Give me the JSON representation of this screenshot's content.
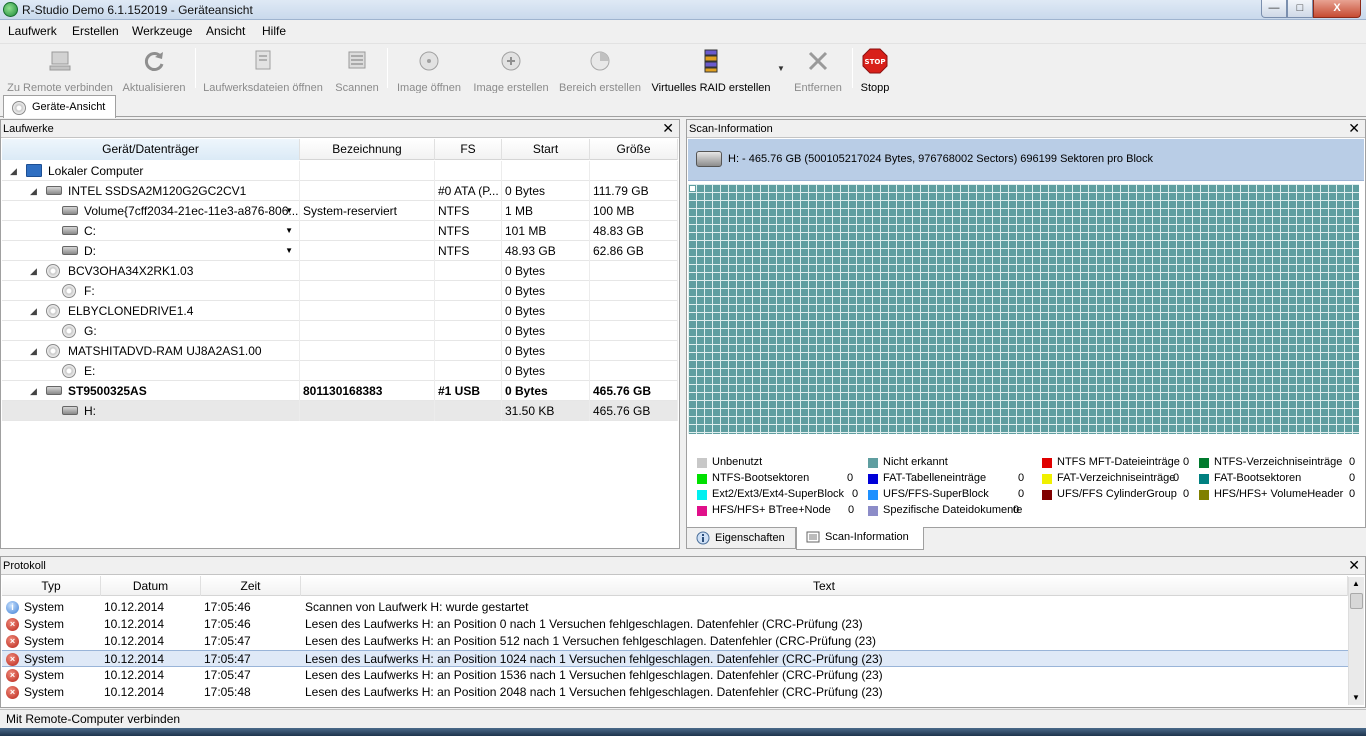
{
  "window": {
    "title": "R-Studio Demo 6.1.152019 - Geräteansicht",
    "min": "—",
    "max": "□",
    "close": "X"
  },
  "menu": [
    "Laufwerk",
    "Erstellen",
    "Werkzeuge",
    "Ansicht",
    "Hilfe"
  ],
  "toolbar": {
    "remote": "Zu Remote verbinden",
    "refresh": "Aktualisieren",
    "open_drive_files": "Laufwerksdateien öffnen",
    "scan": "Scannen",
    "open_image": "Image öffnen",
    "create_image": "Image erstellen",
    "create_region": "Bereich erstellen",
    "virtual_raid": "Virtuelles RAID erstellen",
    "remove": "Entfernen",
    "stop": "Stopp",
    "stop_icon_text": "STOP"
  },
  "tab_main": "Geräte-Ansicht",
  "drives": {
    "title": "Laufwerke",
    "columns": [
      "Gerät/Datenträger",
      "Bezeichnung",
      "FS",
      "Start",
      "Größe"
    ],
    "rows": [
      {
        "name": "Lokaler Computer",
        "label": "",
        "fs": "",
        "start": "",
        "size": ""
      },
      {
        "name": "INTEL SSDSA2M120G2GC2CV1",
        "label": "",
        "fs": "#0 ATA (P...",
        "start": "0 Bytes",
        "size": "111.79 GB"
      },
      {
        "name": "Volume{7cff2034-21ec-11e3-a876-806...",
        "label": "System-reserviert",
        "fs": "NTFS",
        "start": "1 MB",
        "size": "100 MB"
      },
      {
        "name": "C:",
        "label": "",
        "fs": "NTFS",
        "start": "101 MB",
        "size": "48.83 GB"
      },
      {
        "name": "D:",
        "label": "",
        "fs": "NTFS",
        "start": "48.93 GB",
        "size": "62.86 GB"
      },
      {
        "name": "BCV3OHA34X2RK1.03",
        "label": "",
        "fs": "",
        "start": "0 Bytes",
        "size": ""
      },
      {
        "name": "F:",
        "label": "",
        "fs": "",
        "start": "0 Bytes",
        "size": ""
      },
      {
        "name": "ELBYCLONEDRIVE1.4",
        "label": "",
        "fs": "",
        "start": "0 Bytes",
        "size": ""
      },
      {
        "name": "G:",
        "label": "",
        "fs": "",
        "start": "0 Bytes",
        "size": ""
      },
      {
        "name": "MATSHITADVD-RAM UJ8A2AS1.00",
        "label": "",
        "fs": "",
        "start": "0 Bytes",
        "size": ""
      },
      {
        "name": "E:",
        "label": "",
        "fs": "",
        "start": "0 Bytes",
        "size": ""
      },
      {
        "name": "ST9500325AS",
        "label": "801130168383",
        "fs": "#1 USB",
        "start": "0 Bytes",
        "size": "465.76 GB"
      },
      {
        "name": "H:",
        "label": "",
        "fs": "",
        "start": "31.50 KB",
        "size": "465.76 GB"
      }
    ]
  },
  "scan": {
    "title": "Scan-Information",
    "info": "H: - 465.76 GB (500105217024 Bytes, 976768002 Sectors) 696199 Sektoren pro Block",
    "legend": [
      {
        "name": "Unbenutzt",
        "count": "",
        "color": "#c8c8c8"
      },
      {
        "name": "Nicht erkannt",
        "count": "",
        "color": "#5f9ea0"
      },
      {
        "name": "NTFS MFT-Dateieinträge",
        "count": "0",
        "color": "#e00000"
      },
      {
        "name": "NTFS-Verzeichniseinträge",
        "count": "0",
        "color": "#007a2e"
      },
      {
        "name": "NTFS-Bootsektoren",
        "count": "0",
        "color": "#00e000"
      },
      {
        "name": "FAT-Tabelleneinträge",
        "count": "0",
        "color": "#0000d8"
      },
      {
        "name": "FAT-Verzeichniseinträge",
        "count": "0",
        "color": "#f0f000"
      },
      {
        "name": "FAT-Bootsektoren",
        "count": "0",
        "color": "#008080"
      },
      {
        "name": "Ext2/Ext3/Ext4-SuperBlock",
        "count": "0",
        "color": "#00f0f0"
      },
      {
        "name": "UFS/FFS-SuperBlock",
        "count": "0",
        "color": "#1e90ff"
      },
      {
        "name": "UFS/FFS CylinderGroup",
        "count": "0",
        "color": "#800000"
      },
      {
        "name": "HFS/HFS+ VolumeHeader",
        "count": "0",
        "color": "#808000"
      },
      {
        "name": "HFS/HFS+ BTree+Node",
        "count": "0",
        "color": "#e0108a"
      },
      {
        "name": "Spezifische Dateidokumente",
        "count": "0",
        "color": "#8c8cc8"
      }
    ],
    "tabs": [
      "Eigenschaften",
      "Scan-Information"
    ]
  },
  "protocol": {
    "title": "Protokoll",
    "columns": [
      "Typ",
      "Datum",
      "Zeit",
      "Text"
    ],
    "rows": [
      {
        "kind": "info",
        "type": "System",
        "date": "10.12.2014",
        "time": "17:05:46",
        "text": "Scannen von Laufwerk H: wurde gestartet"
      },
      {
        "kind": "error",
        "type": "System",
        "date": "10.12.2014",
        "time": "17:05:46",
        "text": "Lesen des Laufwerks H: an Position 0 nach 1 Versuchen fehlgeschlagen. Datenfehler (CRC-Prüfung (23)"
      },
      {
        "kind": "error",
        "type": "System",
        "date": "10.12.2014",
        "time": "17:05:47",
        "text": "Lesen des Laufwerks H: an Position 512 nach 1 Versuchen fehlgeschlagen. Datenfehler (CRC-Prüfung (23)"
      },
      {
        "kind": "error",
        "type": "System",
        "date": "10.12.2014",
        "time": "17:05:47",
        "text": "Lesen des Laufwerks H: an Position 1024 nach 1 Versuchen fehlgeschlagen. Datenfehler (CRC-Prüfung (23)"
      },
      {
        "kind": "error",
        "type": "System",
        "date": "10.12.2014",
        "time": "17:05:47",
        "text": "Lesen des Laufwerks H: an Position 1536 nach 1 Versuchen fehlgeschlagen. Datenfehler (CRC-Prüfung (23)"
      },
      {
        "kind": "error",
        "type": "System",
        "date": "10.12.2014",
        "time": "17:05:48",
        "text": "Lesen des Laufwerks H: an Position 2048 nach 1 Versuchen fehlgeschlagen. Datenfehler (CRC-Prüfung (23)"
      }
    ]
  },
  "status": "Mit Remote-Computer verbinden",
  "close_glyph": "✕"
}
